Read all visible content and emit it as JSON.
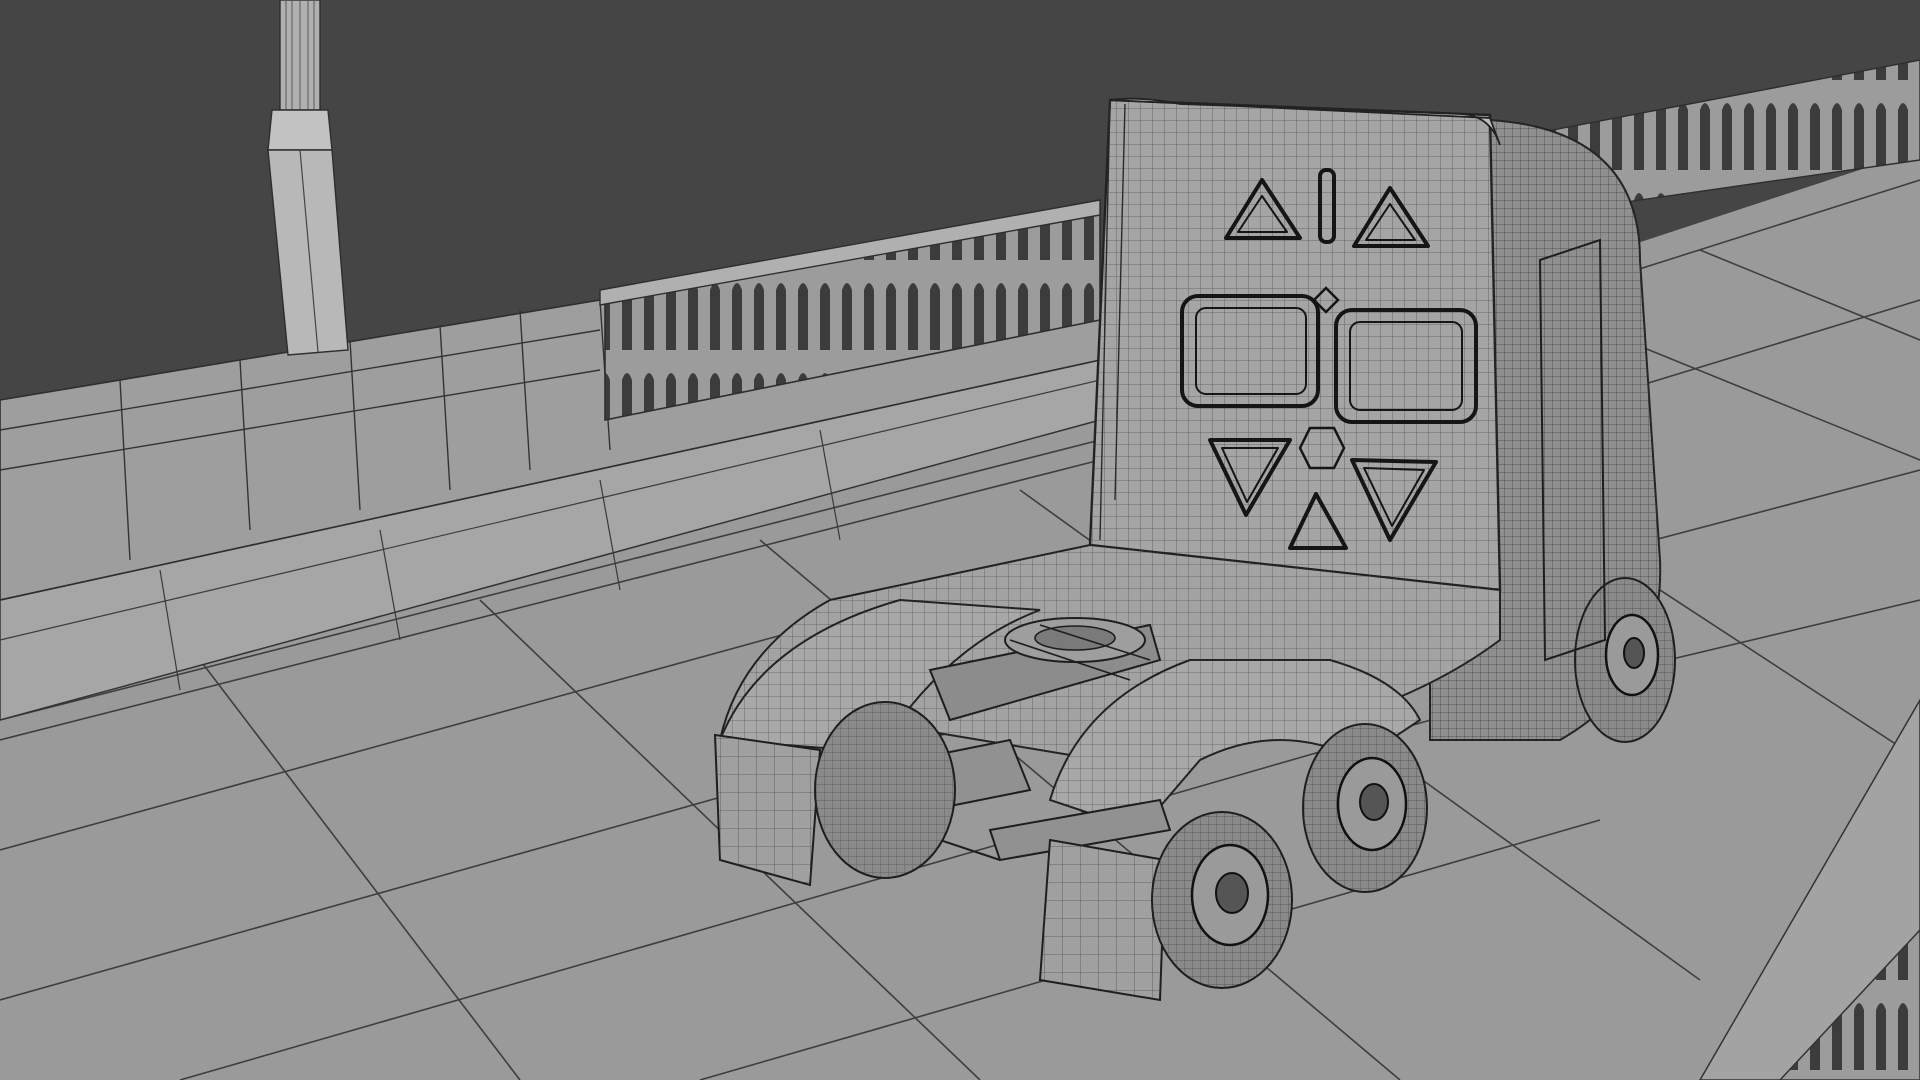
{
  "scene": {
    "subject": "semi-truck-tractor-wireframe",
    "render_mode": "wireframe-on-shaded",
    "colors": {
      "background": "#454545",
      "surface": "#9a9a9a",
      "surface_light": "#b4b4b4",
      "surface_dark": "#7e7e7e",
      "wire": "#2b2b2b",
      "wire_light": "#5a5a5a"
    }
  }
}
